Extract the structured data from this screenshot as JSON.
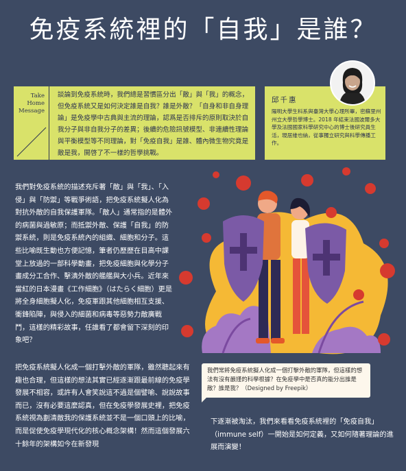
{
  "title": "免疫系統裡的「自我」是誰？",
  "intro": {
    "take_home": [
      "Take",
      "Home",
      "Message"
    ],
    "text": "談論到免疫系統時，我們總是習慣區分出「敵」與「我」的概念，但免疫系統又是如何決定誰是自我？誰是外敵？「自身和非自身理論」是免疫學中古典與主流的理論，認爲是否排斥的原則取決於自我分子與非自我分子的差異；後續的危險訊號模型、非連續性理論與平衡模型等不同理論，對「免疫自我」是誰、體內微生物究竟是敵是我，開啓了不一樣的哲學挑戰。"
  },
  "author": {
    "name": "邱千惠",
    "bio": "陽明大學生科系與臺灣大學心理所畢，密蘇里州州立大學哲學博士。2018 年結束法國波爾多大學及法國國家科學研究中心的博士後研究員生活，現居維也納，從事獨立研究與科學傳播工作。"
  },
  "paragraph1": "我們對免疫系統的描述充斥著「敵」與「我」、「入侵」與「防禦」等戰爭術語，把免疫系統擬人化為對抗外敵的自我保護軍隊。「敵人」通常指的是體外的病菌與過敏原；而抵禦外敵、保護「自我」的防禦系統，則是免疫系統內的組織、細胞和分子。這些比喻既生動也方便記憶，筆者仍歷歷在目高中課堂上放過的一部科學動畫，把免疫細胞與化學分子畫成分工合作、擊潰外敵的艦艦與大小兵。近年來當紅的日本漫畫《工作細胞》（はたらく細胞）更是將全身細胞擬人化，免疫軍跟其他細胞相互支援、衝鋒陷陣，與侵入的細菌和病毒等惡勢力敵廣戰鬥，這樣的精彩故事，任誰看了都會留下深刻的印象吧？",
  "paragraph2": "把免疫系統擬人化成一個打擊外敵的軍隊，雖然聽起來有趣也合理，但這樣的想法其實已經逐漸跟最前線的免疫學發展不相容，或許有人會笑說這不過是個譬喻、說說故事而已，沒有必要這麼認真，但在免疫學發展史裡，把免疫系統視為劃清敵我的保護系統並不是一個口頭上的比喻，而是促使免疫學現代化的核心概念架構！然而這個發展六十餘年的架構如今在新發現",
  "paragraph3": "下逐漸被淘汰，我們來看看免疫系統裡的「免疫自我」（immune self）一開始是如何定義，又如何隨著理論的進展而演變！",
  "caption": "我們常將免疫系統擬人化成一個打擊外敵的軍隊，但這樣的想法有沒有嚴謹的科學根據？在免疫學中是否真的能分出誰是敵？誰是我？（Designed by Freepik）",
  "colors": {
    "background": "#3d4a63",
    "accent": "#d9e26a",
    "virus": "#d63a2f",
    "shield": "#7b5aa6",
    "blob": "#f5b935"
  }
}
